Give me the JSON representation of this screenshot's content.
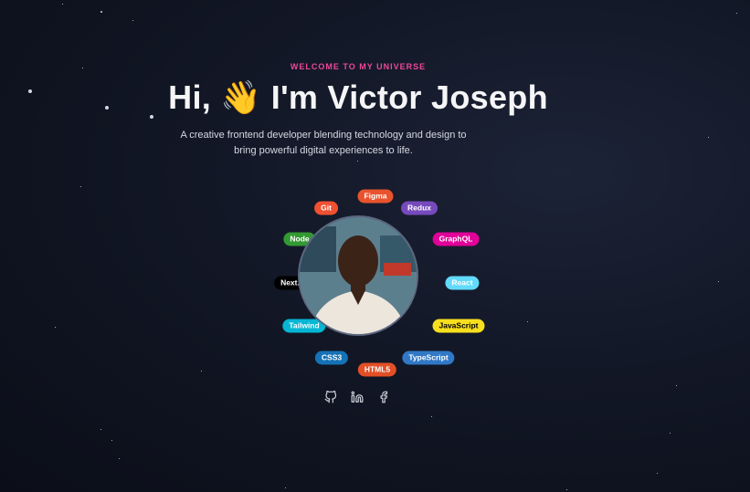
{
  "hero": {
    "eyebrow": "WELCOME TO MY UNIVERSE",
    "headline": "Hi, 👋 I'm Victor Joseph",
    "tagline": "A creative frontend developer blending technology and design to bring powerful digital experiences to life."
  },
  "skills": [
    {
      "label": "Figma",
      "bg": "#e8532e",
      "fg": "#ffffff"
    },
    {
      "label": "Redux",
      "bg": "#764abc",
      "fg": "#ffffff"
    },
    {
      "label": "GraphQL",
      "bg": "#e10098",
      "fg": "#ffffff"
    },
    {
      "label": "React",
      "bg": "#61dafb",
      "fg": "#ffffff"
    },
    {
      "label": "JavaScript",
      "bg": "#f7df1e",
      "fg": "#000000"
    },
    {
      "label": "TypeScript",
      "bg": "#3178c6",
      "fg": "#ffffff"
    },
    {
      "label": "HTML5",
      "bg": "#e34f26",
      "fg": "#ffffff"
    },
    {
      "label": "CSS3",
      "bg": "#1572b6",
      "fg": "#ffffff"
    },
    {
      "label": "Tailwind",
      "bg": "#06b6d4",
      "fg": "#ffffff"
    },
    {
      "label": "Next.js",
      "bg": "#000000",
      "fg": "#ffffff"
    },
    {
      "label": "Node",
      "bg": "#339933",
      "fg": "#ffffff"
    },
    {
      "label": "Git",
      "bg": "#f05032",
      "fg": "#ffffff"
    }
  ],
  "socials": [
    {
      "icon": "github-icon"
    },
    {
      "icon": "linkedin-icon"
    },
    {
      "icon": "facebook-icon"
    }
  ]
}
